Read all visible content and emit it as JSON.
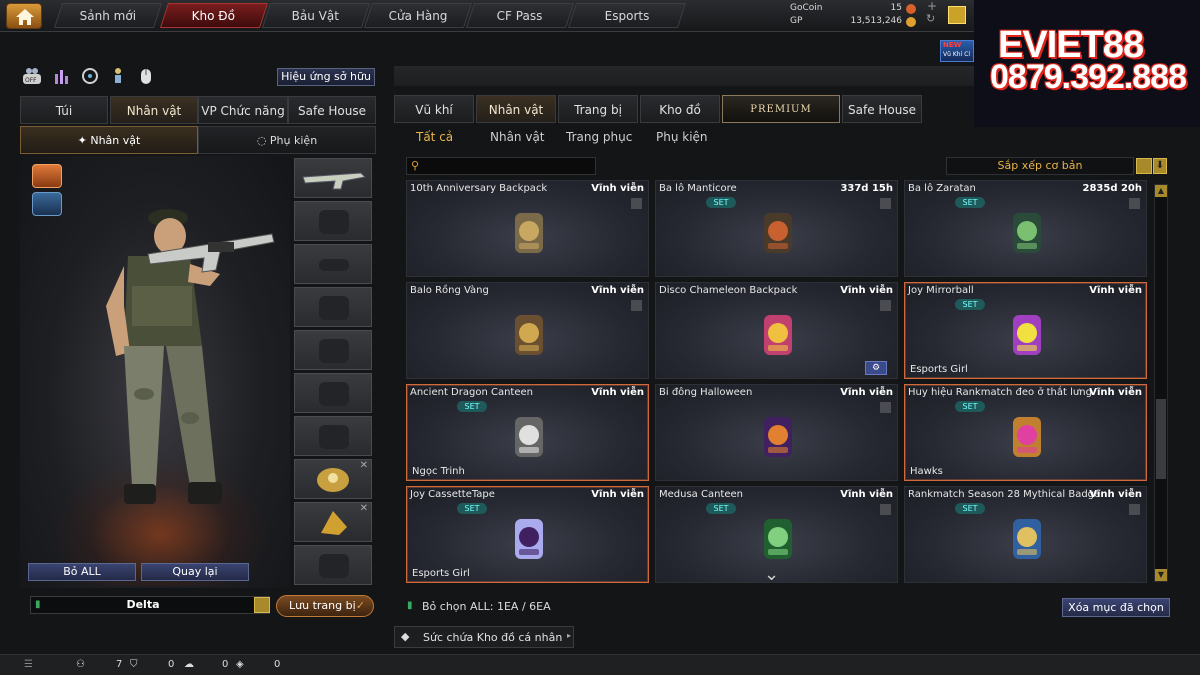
{
  "topnav": {
    "tabs": [
      "Sảnh mới",
      "Kho Đồ",
      "Bảu Vật",
      "Cửa Hàng",
      "CF Pass",
      "Esports"
    ],
    "active_index": 1
  },
  "currency": {
    "gocoin_label": "GoCoin",
    "gocoin_value": "15",
    "gp_label": "GP",
    "gp_value": "13,513,246"
  },
  "promo": {
    "new_label": "NEW",
    "new_sub": "Vũ Khí Cl",
    "line1": "EVIET88",
    "line2": "0879.392.888"
  },
  "left": {
    "effect_button": "Hiệu ứng sở hữu",
    "tabs": [
      "Túi",
      "Nhân vật",
      "VP Chức năng",
      "Safe House"
    ],
    "subtabs": [
      "Nhân vật",
      "Phụ kiện"
    ],
    "reset_all": "Bỏ ALL",
    "back": "Quay lại",
    "preset_name": "Delta",
    "save_button": "Lưu trang bị"
  },
  "right": {
    "tabs": [
      "Vũ khí",
      "Nhân vật",
      "Trang bị",
      "Kho đồ",
      "PREMIUM",
      "Safe House"
    ],
    "subtabs": [
      "Tất cả",
      "Nhân vật",
      "Trang phục",
      "Phụ kiện"
    ],
    "sort_label": "Sắp xếp cơ bản",
    "selection_text": "Bỏ chọn ALL: 1EA / 6EA",
    "clear_button": "Xóa mục đã chọn",
    "capacity_label": "Sức chứa Kho đồ cá nhân"
  },
  "items": [
    {
      "name": "10th Anniversary Backpack",
      "duration": "Vĩnh viễn",
      "set": false,
      "owner": "",
      "highlight": false
    },
    {
      "name": "Ba lô Manticore",
      "duration": "337d 15h",
      "set": true,
      "set_label": "SET",
      "owner": "",
      "highlight": false
    },
    {
      "name": "Ba lô Zaratan",
      "duration": "2835d 20h",
      "set": true,
      "set_label": "SET",
      "owner": "",
      "highlight": false
    },
    {
      "name": "Balo Rồng Vàng",
      "duration": "Vĩnh viễn",
      "set": false,
      "owner": "",
      "highlight": false
    },
    {
      "name": "Disco Chameleon Backpack",
      "duration": "Vĩnh viễn",
      "set": false,
      "owner": "",
      "highlight": false
    },
    {
      "name": "Joy Mirrorball",
      "duration": "Vĩnh viễn",
      "set": true,
      "set_label": "SET",
      "owner": "Esports Girl",
      "highlight": true
    },
    {
      "name": "Ancient Dragon Canteen",
      "duration": "Vĩnh viễn",
      "set": true,
      "set_label": "SET",
      "owner": "Ngọc Trinh",
      "highlight": true
    },
    {
      "name": "Bi đông Halloween",
      "duration": "Vĩnh viễn",
      "set": false,
      "owner": "",
      "highlight": false
    },
    {
      "name": "Huy hiệu Rankmatch đeo ở thắt lưng",
      "duration": "Vĩnh viễn",
      "set": true,
      "set_label": "SET",
      "owner": "Hawks",
      "highlight": true
    },
    {
      "name": "Joy CassetteTape",
      "duration": "Vĩnh viễn",
      "set": true,
      "set_label": "SET",
      "owner": "Esports Girl",
      "highlight": true
    },
    {
      "name": "Medusa Canteen",
      "duration": "Vĩnh viễn",
      "set": true,
      "set_label": "SET",
      "owner": "",
      "highlight": false
    },
    {
      "name": "Rankmatch Season 28 Mythical Badge",
      "duration": "Vĩnh viễn",
      "set": true,
      "set_label": "SET",
      "owner": "",
      "highlight": false
    }
  ],
  "bottom": {
    "stat1": "7",
    "stat2": "0",
    "stat3": "0",
    "stat4": "0"
  }
}
